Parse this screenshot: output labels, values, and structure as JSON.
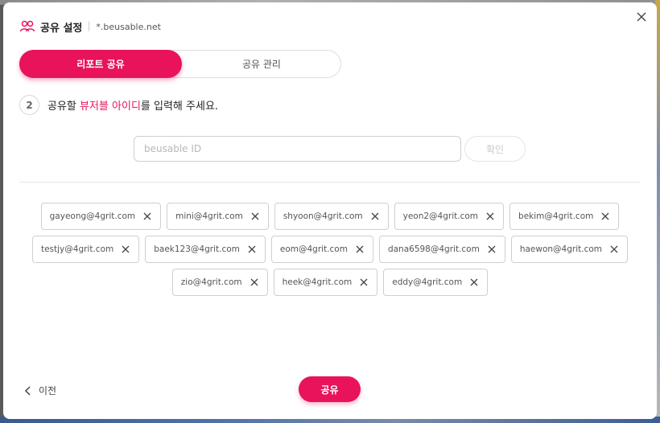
{
  "header": {
    "title": "공유 설정",
    "domain": "*.beusable.net"
  },
  "tabs": [
    {
      "label": "리포트 공유",
      "active": true
    },
    {
      "label": "공유 관리",
      "active": false
    }
  ],
  "step": {
    "number": "2",
    "text_before": "공유할 ",
    "text_highlight": "뷰저블 아이디",
    "text_after": "를 입력해 주세요."
  },
  "id_input": {
    "placeholder": "beusable ID",
    "value": ""
  },
  "confirm_label": "확인",
  "chips": [
    [
      "gayeong@4grit.com",
      "mini@4grit.com",
      "shyoon@4grit.com",
      "yeon2@4grit.com",
      "bekim@4grit.com"
    ],
    [
      "testjy@4grit.com",
      "baek123@4grit.com",
      "eom@4grit.com",
      "dana6598@4grit.com",
      "haewon@4grit.com"
    ],
    [
      "zio@4grit.com",
      "heek@4grit.com",
      "eddy@4grit.com"
    ]
  ],
  "footer": {
    "prev_label": "이전",
    "share_label": "공유"
  },
  "colors": {
    "accent": "#e8135b"
  },
  "icons": {
    "share": "share-users-icon",
    "close": "close-icon",
    "chip_remove": "x-icon",
    "prev": "chevron-left-icon"
  }
}
